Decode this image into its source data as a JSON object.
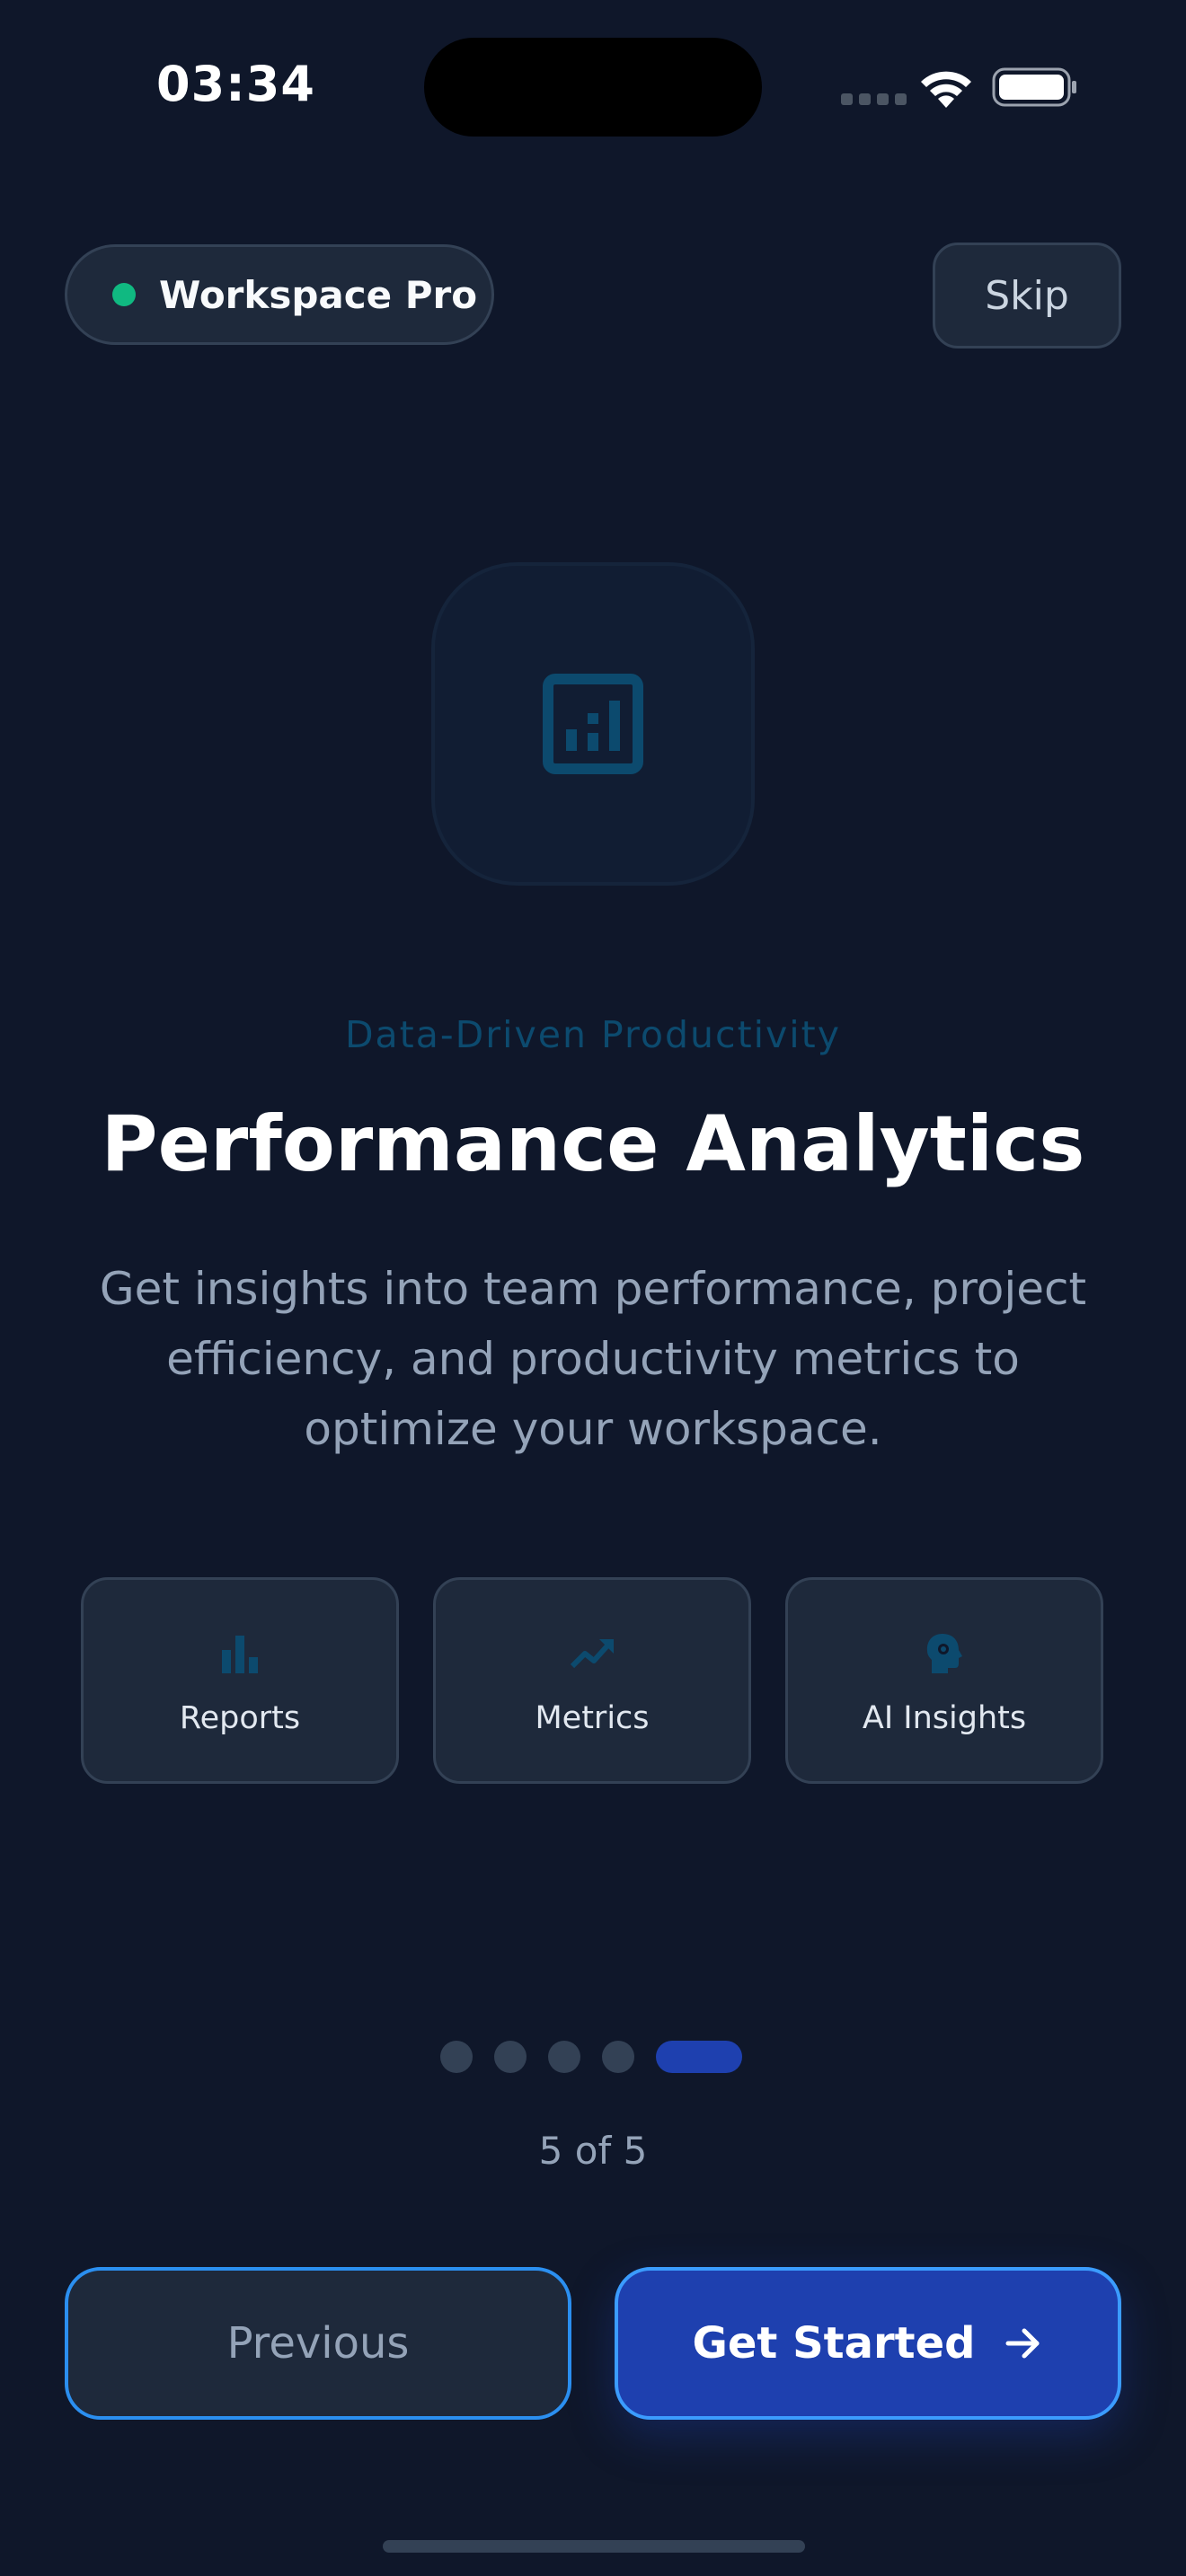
{
  "status_bar": {
    "time": "03:34",
    "icons": [
      "signal-dots-icon",
      "wifi-icon",
      "battery-icon"
    ]
  },
  "header": {
    "workspace_label": "Workspace Pro",
    "skip_label": "Skip"
  },
  "hero": {
    "icon": "analytics-chart-icon",
    "eyebrow": "Data-Driven Productivity",
    "title": "Performance Analytics",
    "description": "Get insights into team performance, project efficiency, and productivity metrics to optimize your workspace."
  },
  "features": [
    {
      "label": "Reports",
      "icon": "bar-chart-icon"
    },
    {
      "label": "Metrics",
      "icon": "trending-up-icon"
    },
    {
      "label": "AI Insights",
      "icon": "brain-gear-icon"
    }
  ],
  "pagination": {
    "current": 5,
    "total": 5,
    "label": "5 of 5"
  },
  "actions": {
    "previous_label": "Previous",
    "next_label": "Get Started"
  },
  "colors": {
    "background": "#0f172a",
    "card": "#1e293b",
    "border": "#334155",
    "accent": "#1e40af",
    "accent_border": "#3b9cff",
    "status_online": "#10b981",
    "eyebrow": "#0c4a6e",
    "muted_text": "#94a3b8"
  }
}
